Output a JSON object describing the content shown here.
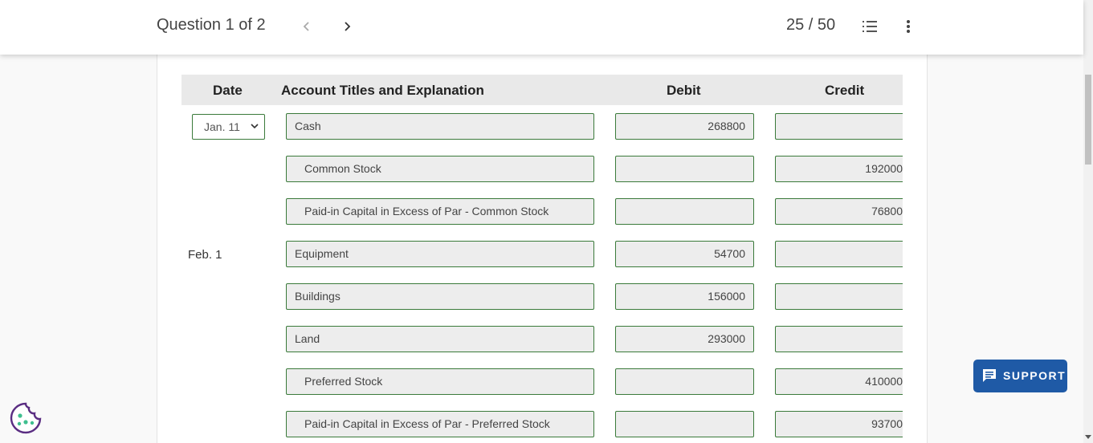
{
  "header": {
    "question_label": "Question 1 of 2",
    "progress": "25 / 50"
  },
  "table": {
    "headers": {
      "date": "Date",
      "account": "Account Titles and Explanation",
      "debit": "Debit",
      "credit": "Credit"
    },
    "date_select_value": "Jan. 11",
    "date_feb": "Feb. 1",
    "rows": [
      {
        "account": "Cash",
        "debit": "268800",
        "credit": ""
      },
      {
        "account": "Common Stock",
        "debit": "",
        "credit": "192000"
      },
      {
        "account": "Paid-in Capital in Excess of Par - Common Stock",
        "debit": "",
        "credit": "76800"
      },
      {
        "account": "Equipment",
        "debit": "54700",
        "credit": ""
      },
      {
        "account": "Buildings",
        "debit": "156000",
        "credit": ""
      },
      {
        "account": "Land",
        "debit": "293000",
        "credit": ""
      },
      {
        "account": "Preferred Stock",
        "debit": "",
        "credit": "410000"
      },
      {
        "account": "Paid-in Capital in Excess of Par - Preferred Stock",
        "debit": "",
        "credit": "93700"
      }
    ]
  },
  "support": {
    "label": "SUPPORT"
  },
  "colors": {
    "field_border": "#3a7a3a",
    "support_bg": "#1f5aa6",
    "cookie": "#5a2d82"
  }
}
